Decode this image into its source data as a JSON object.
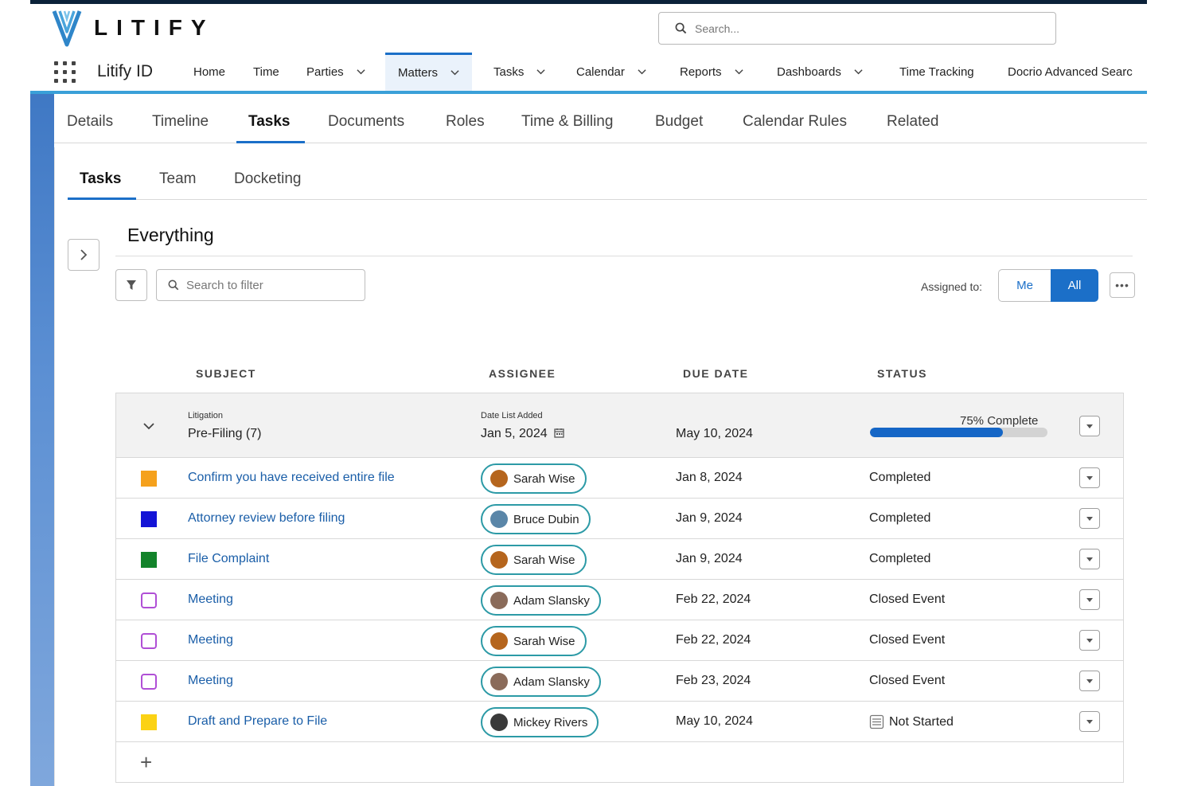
{
  "app": {
    "logo_text": "LITIFY",
    "search_placeholder": "Search...",
    "app_name": "Litify ID",
    "brand_color": "#1b6fc8"
  },
  "nav": {
    "items": [
      {
        "label": "Home",
        "dropdown": false,
        "active": false
      },
      {
        "label": "Time",
        "dropdown": false,
        "active": false
      },
      {
        "label": "Parties",
        "dropdown": true,
        "active": false
      },
      {
        "label": "Matters",
        "dropdown": true,
        "active": true
      },
      {
        "label": "Tasks",
        "dropdown": true,
        "active": false
      },
      {
        "label": "Calendar",
        "dropdown": true,
        "active": false
      },
      {
        "label": "Reports",
        "dropdown": true,
        "active": false
      },
      {
        "label": "Dashboards",
        "dropdown": true,
        "active": false
      },
      {
        "label": "Time Tracking",
        "dropdown": false,
        "active": false
      },
      {
        "label": "Docrio Advanced Searc",
        "dropdown": false,
        "active": false
      }
    ]
  },
  "record_tabs": [
    "Details",
    "Timeline",
    "Tasks",
    "Documents",
    "Roles",
    "Time & Billing",
    "Budget",
    "Calendar Rules",
    "Related"
  ],
  "record_tabs_active": "Tasks",
  "sub_tabs": [
    "Tasks",
    "Team",
    "Docketing"
  ],
  "sub_tabs_active": "Tasks",
  "list": {
    "title": "Everything",
    "filter_placeholder": "Search to filter",
    "assigned_label": "Assigned to:",
    "assigned_options": [
      "Me",
      "All"
    ],
    "assigned_selected": "All",
    "more_label": "•••"
  },
  "columns": [
    "SUBJECT",
    "ASSIGNEE",
    "DUE DATE",
    "STATUS"
  ],
  "group": {
    "category_label": "Litigation",
    "name": "Pre-Filing (7)",
    "date_label": "Date List Added",
    "date_added": "Jan 5, 2024",
    "due_date": "May 10, 2024",
    "progress_text": "75% Complete",
    "progress_fraction": 0.75
  },
  "tasks": [
    {
      "subject": "Confirm you have received entire file",
      "color": "#f5a11c",
      "outline": false,
      "assignee": "Sarah Wise",
      "avatar_color": "#b5651d",
      "due": "Jan 8, 2024",
      "status": "Completed",
      "status_icon": false
    },
    {
      "subject": "Attorney review before filing",
      "color": "#1414d6",
      "outline": false,
      "assignee": "Bruce Dubin",
      "avatar_color": "#5a86a8",
      "due": "Jan 9, 2024",
      "status": "Completed",
      "status_icon": false
    },
    {
      "subject": "File Complaint",
      "color": "#12832a",
      "outline": false,
      "assignee": "Sarah Wise",
      "avatar_color": "#b5651d",
      "due": "Jan 9, 2024",
      "status": "Completed",
      "status_icon": false
    },
    {
      "subject": "Meeting",
      "color": "#b04fd6",
      "outline": true,
      "assignee": "Adam Slansky",
      "avatar_color": "#8a6b5a",
      "due": "Feb 22, 2024",
      "status": "Closed Event",
      "status_icon": false
    },
    {
      "subject": "Meeting",
      "color": "#b04fd6",
      "outline": true,
      "assignee": "Sarah Wise",
      "avatar_color": "#b5651d",
      "due": "Feb 22, 2024",
      "status": "Closed Event",
      "status_icon": false
    },
    {
      "subject": "Meeting",
      "color": "#b04fd6",
      "outline": true,
      "assignee": "Adam Slansky",
      "avatar_color": "#8a6b5a",
      "due": "Feb 23, 2024",
      "status": "Closed Event",
      "status_icon": false
    },
    {
      "subject": "Draft and Prepare to File",
      "color": "#fbd214",
      "outline": false,
      "assignee": "Mickey Rivers",
      "avatar_color": "#3a3a3a",
      "due": "May 10, 2024",
      "status": "Not Started",
      "status_icon": true
    }
  ],
  "add_label": "+"
}
